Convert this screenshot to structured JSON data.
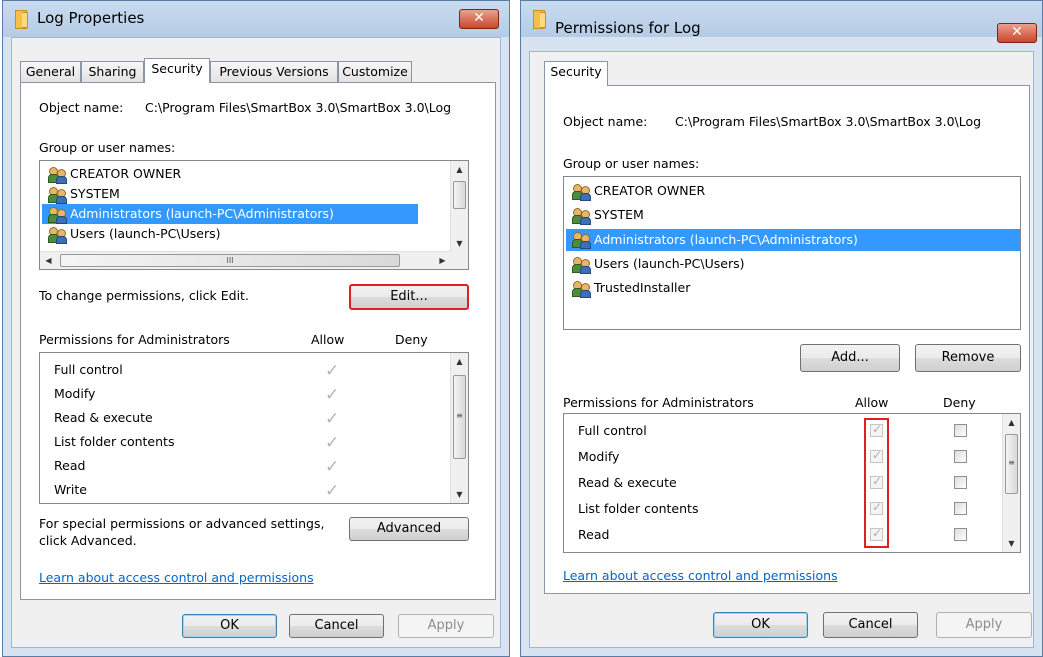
{
  "left": {
    "title": "Log Properties",
    "tabs": [
      "General",
      "Sharing",
      "Security",
      "Previous Versions",
      "Customize"
    ],
    "object_label": "Object name:",
    "object_value": "C:\\Program Files\\SmartBox 3.0\\SmartBox 3.0\\Log",
    "group_label": "Group or user names:",
    "users": [
      "CREATOR OWNER",
      "SYSTEM",
      "Administrators (launch-PC\\Administrators)",
      "Users (launch-PC\\Users)"
    ],
    "change_text": "To change permissions, click Edit.",
    "edit_label": "Edit...",
    "perm_header": "Permissions for Administrators",
    "allow_label": "Allow",
    "deny_label": "Deny",
    "permissions": [
      "Full control",
      "Modify",
      "Read & execute",
      "List folder contents",
      "Read",
      "Write"
    ],
    "special_text_1": "For special permissions or advanced settings,",
    "special_text_2": "click Advanced.",
    "advanced_label": "Advanced",
    "link": "Learn about access control and permissions",
    "ok": "OK",
    "cancel": "Cancel",
    "apply": "Apply",
    "close_glyph": "✕",
    "hscroll_mark": "III"
  },
  "right": {
    "title": "Permissions for Log",
    "tab": "Security",
    "object_label": "Object name:",
    "object_value": "C:\\Program Files\\SmartBox 3.0\\SmartBox 3.0\\Log",
    "group_label": "Group or user names:",
    "users": [
      "CREATOR OWNER",
      "SYSTEM",
      "Administrators (launch-PC\\Administrators)",
      "Users (launch-PC\\Users)",
      "TrustedInstaller"
    ],
    "add_label": "Add...",
    "remove_label": "Remove",
    "perm_header": "Permissions for Administrators",
    "allow_label": "Allow",
    "deny_label": "Deny",
    "permissions": [
      "Full control",
      "Modify",
      "Read & execute",
      "List folder contents",
      "Read"
    ],
    "link": "Learn about access control and permissions",
    "ok": "OK",
    "cancel": "Cancel",
    "apply": "Apply",
    "close_glyph": "✕"
  },
  "colors": {
    "selection": "#3399ff",
    "highlight_box": "#e02020",
    "link": "#0066cc"
  }
}
